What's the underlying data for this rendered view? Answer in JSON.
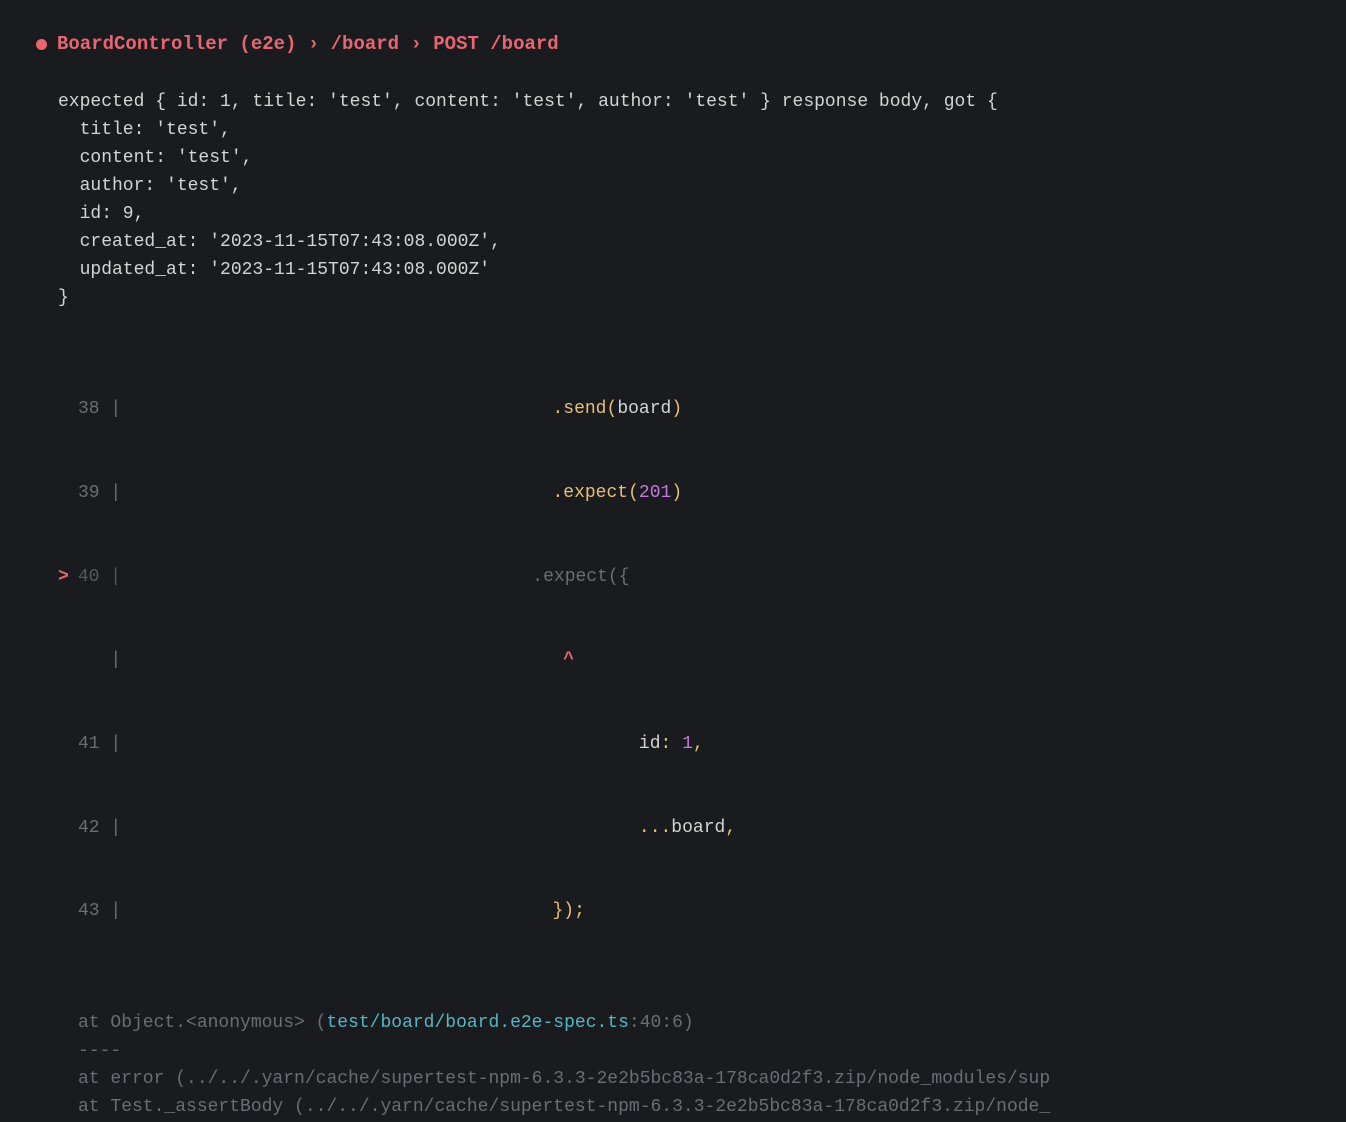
{
  "header": {
    "title": "BoardController (e2e) › /board › POST /board"
  },
  "error": {
    "line1": "expected { id: 1, title: 'test', content: 'test', author: 'test' } response body, got {",
    "line2": "  title: 'test',",
    "line3": "  content: 'test',",
    "line4": "  author: 'test',",
    "line5": "  id: 9,",
    "line6": "  created_at: '2023-11-15T07:43:08.000Z',",
    "line7": "  updated_at: '2023-11-15T07:43:08.000Z'",
    "line8": "}"
  },
  "code": {
    "line38": {
      "num": "38",
      "prefix": "                                      ",
      "dot": ".",
      "method": "send",
      "paren_open": "(",
      "arg": "board",
      "paren_close": ")"
    },
    "line39": {
      "num": "39",
      "prefix": "                                      ",
      "dot": ".",
      "method": "expect",
      "paren_open": "(",
      "arg": "201",
      "paren_close": ")"
    },
    "line40": {
      "num": "40",
      "prefix": "                                      ",
      "dot": ".",
      "method": "expect",
      "paren_open": "(",
      "brace": "{"
    },
    "line_caret": {
      "prefix": "                                       ",
      "caret": "^"
    },
    "line41": {
      "num": "41",
      "prefix": "                                              ",
      "key": "id",
      "colon": ":",
      "space": " ",
      "val": "1",
      "comma": ","
    },
    "line42": {
      "num": "42",
      "prefix": "                                              ",
      "spread": "...",
      "arg": "board",
      "comma": ","
    },
    "line43": {
      "num": "43",
      "prefix": "                                      ",
      "close": "});"
    }
  },
  "stack": {
    "at1_prefix": "at Object.<anonymous> (",
    "at1_link": "test/board/board.e2e-spec.ts",
    "at1_loc": ":40:6",
    "at1_close": ")",
    "rule": "----",
    "at2": "at error (../../.yarn/cache/supertest-npm-6.3.3-2e2b5bc83a-178ca0d2f3.zip/node_modules/sup",
    "at3": "at Test._assertBody (../../.yarn/cache/supertest-npm-6.3.3-2e2b5bc83a-178ca0d2f3.zip/node_"
  }
}
